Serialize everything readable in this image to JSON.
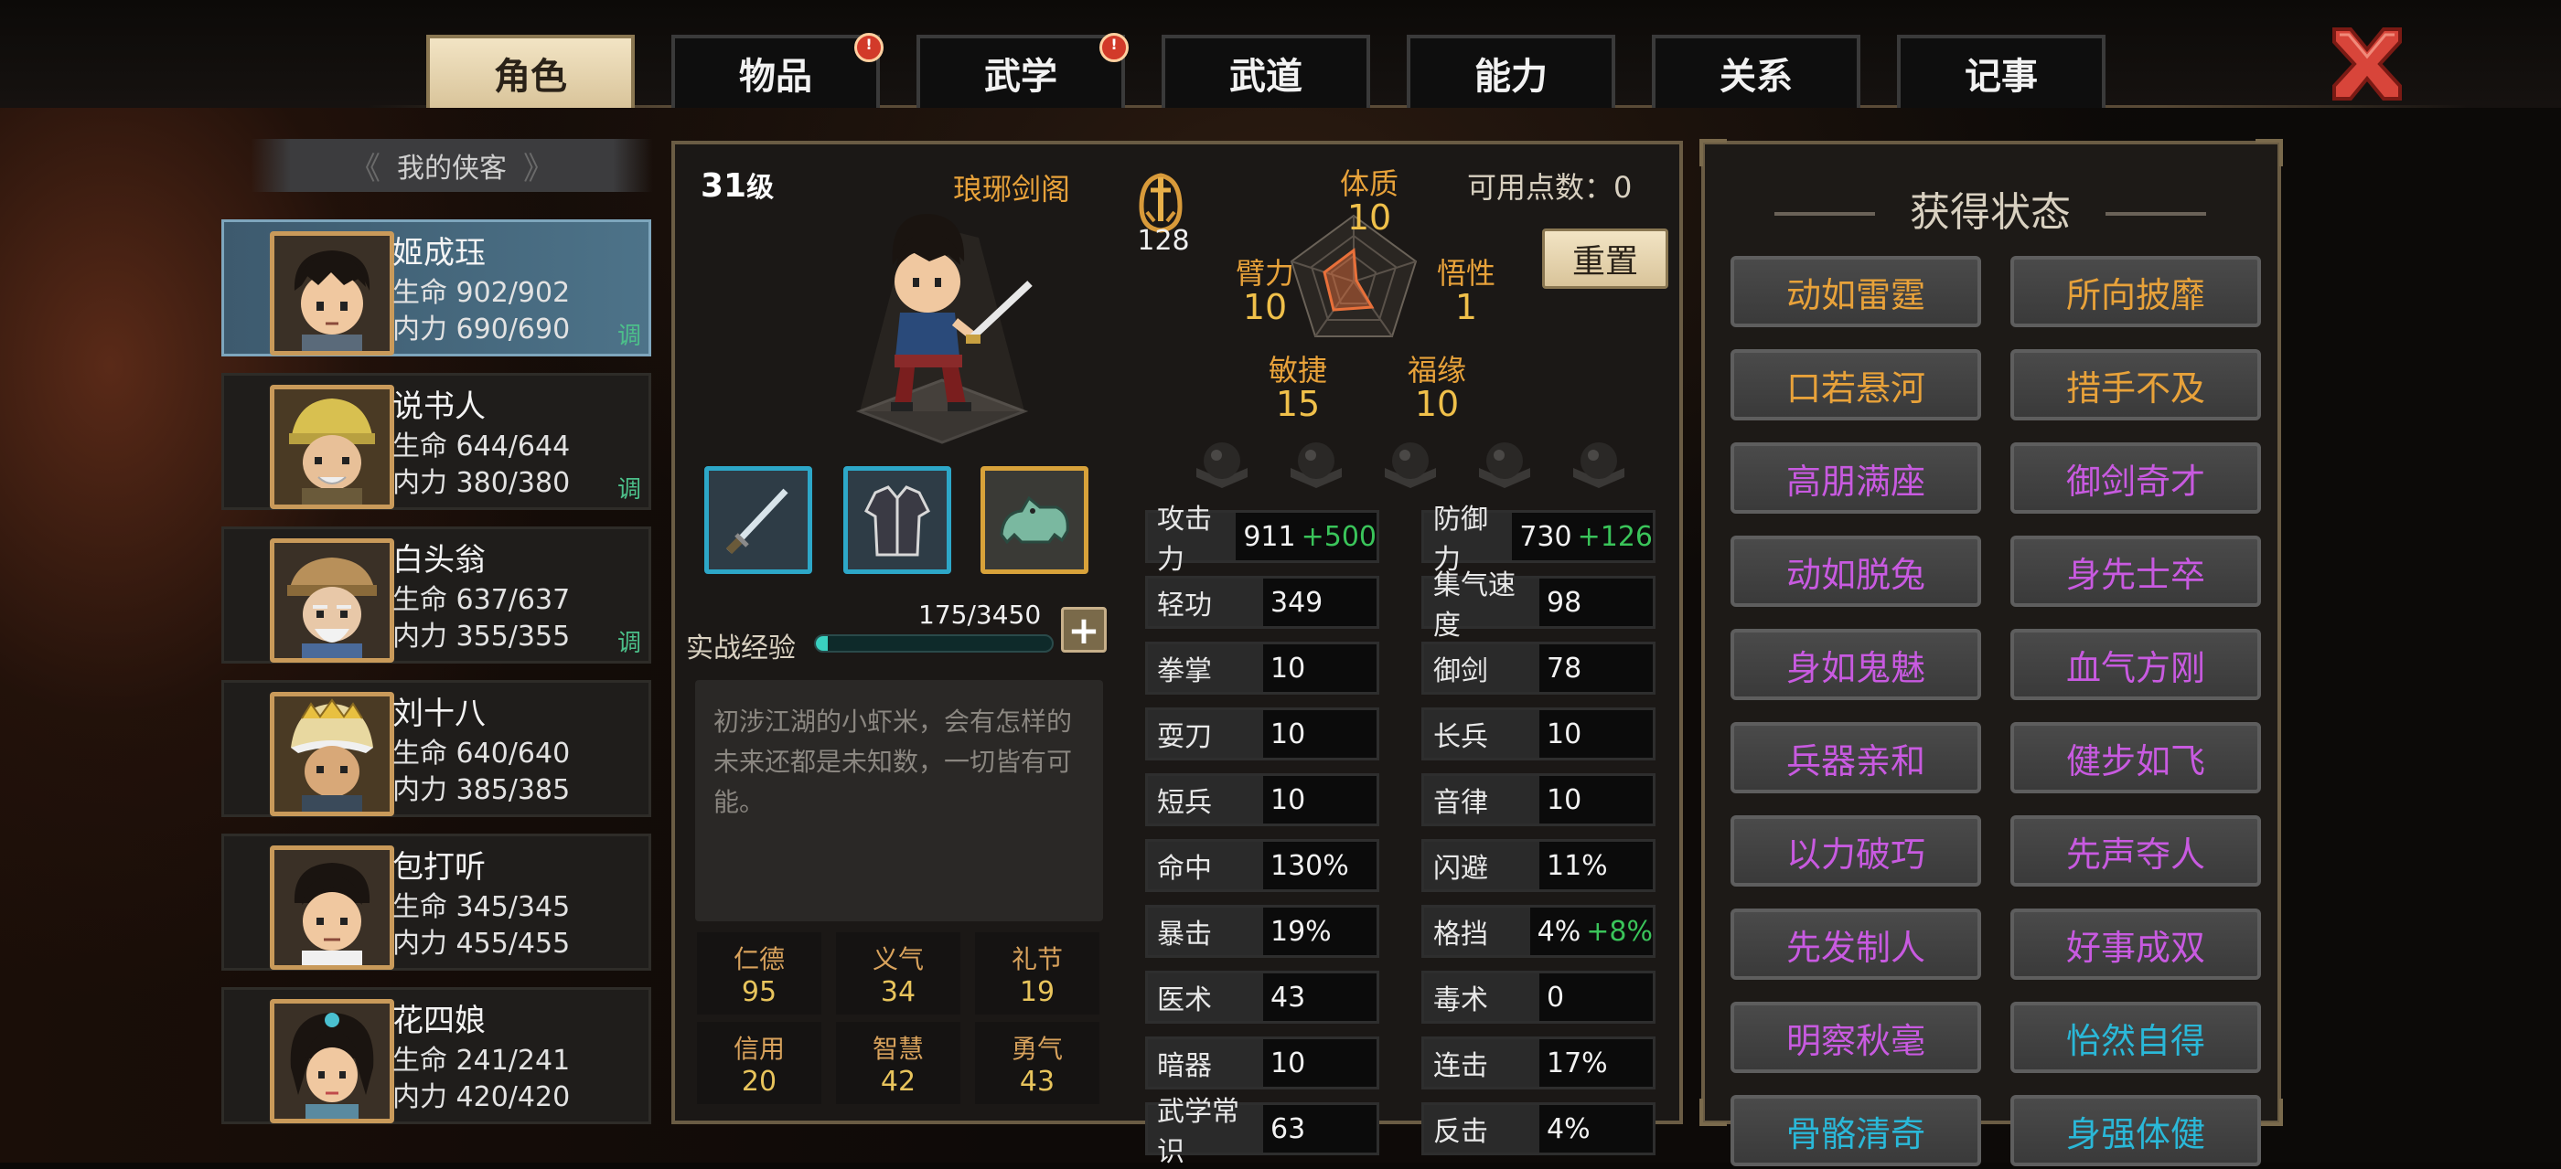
{
  "tabs": [
    {
      "label": "角色",
      "active": true,
      "badge": false
    },
    {
      "label": "物品",
      "active": false,
      "badge": true
    },
    {
      "label": "武学",
      "active": false,
      "badge": true
    },
    {
      "label": "武道",
      "active": false,
      "badge": false
    },
    {
      "label": "能力",
      "active": false,
      "badge": false
    },
    {
      "label": "关系",
      "active": false,
      "badge": false
    },
    {
      "label": "记事",
      "active": false,
      "badge": false
    }
  ],
  "badge_mark": "!",
  "section_title": "我的侠客",
  "heroes": [
    {
      "name": "姬成珏",
      "hp": "生命 902/902",
      "mp": "内力 690/690",
      "tag": "调"
    },
    {
      "name": "说书人",
      "hp": "生命 644/644",
      "mp": "内力 380/380",
      "tag": "调"
    },
    {
      "name": "白头翁",
      "hp": "生命 637/637",
      "mp": "内力 355/355",
      "tag": "调"
    },
    {
      "name": "刘十八",
      "hp": "生命 640/640",
      "mp": "内力 385/385",
      "tag": ""
    },
    {
      "name": "包打听",
      "hp": "生命 345/345",
      "mp": "内力 455/455",
      "tag": ""
    },
    {
      "name": "花四娘",
      "hp": "生命 241/241",
      "mp": "内力 420/420",
      "tag": ""
    }
  ],
  "character": {
    "level": "31",
    "level_unit": "级",
    "sect": "琅琊剑阁",
    "power": "128",
    "points_label": "可用点数：",
    "points": "0",
    "reset_label": "重置",
    "exp_label": "实战经验",
    "exp_text": "175/3450",
    "exp_progress": 0.051,
    "plus": "+",
    "description": "初涉江湖的小虾米，会有怎样的未来还都是未知数，一切皆有可能。"
  },
  "attributes": [
    {
      "name": "体质",
      "value": "10"
    },
    {
      "name": "悟性",
      "value": "1"
    },
    {
      "name": "福缘",
      "value": "10"
    },
    {
      "name": "敏捷",
      "value": "15"
    },
    {
      "name": "臂力",
      "value": "10"
    }
  ],
  "virtues": [
    {
      "name": "仁德",
      "value": "95"
    },
    {
      "name": "义气",
      "value": "34"
    },
    {
      "name": "礼节",
      "value": "19"
    },
    {
      "name": "信用",
      "value": "20"
    },
    {
      "name": "智慧",
      "value": "42"
    },
    {
      "name": "勇气",
      "value": "43"
    }
  ],
  "stats_left": [
    {
      "k": "攻击力",
      "v": "911",
      "b": "+500"
    },
    {
      "k": "轻功",
      "v": "349",
      "b": ""
    },
    {
      "k": "拳掌",
      "v": "10",
      "b": ""
    },
    {
      "k": "耍刀",
      "v": "10",
      "b": ""
    },
    {
      "k": "短兵",
      "v": "10",
      "b": ""
    },
    {
      "k": "命中",
      "v": "130%",
      "b": ""
    },
    {
      "k": "暴击",
      "v": "19%",
      "b": ""
    },
    {
      "k": "医术",
      "v": "43",
      "b": ""
    },
    {
      "k": "暗器",
      "v": "10",
      "b": ""
    },
    {
      "k": "武学常识",
      "v": "63",
      "b": ""
    }
  ],
  "stats_right": [
    {
      "k": "防御力",
      "v": "730",
      "b": "+126"
    },
    {
      "k": "集气速度",
      "v": "98",
      "b": ""
    },
    {
      "k": "御剑",
      "v": "78",
      "b": ""
    },
    {
      "k": "长兵",
      "v": "10",
      "b": ""
    },
    {
      "k": "音律",
      "v": "10",
      "b": ""
    },
    {
      "k": "闪避",
      "v": "11%",
      "b": ""
    },
    {
      "k": "格挡",
      "v": "4%",
      "b": "+8%"
    },
    {
      "k": "毒术",
      "v": "0",
      "b": ""
    },
    {
      "k": "连击",
      "v": "17%",
      "b": ""
    },
    {
      "k": "反击",
      "v": "4%",
      "b": ""
    }
  ],
  "status_title": "获得状态",
  "statuses": [
    {
      "label": "动如雷霆",
      "color": "#e8a23a"
    },
    {
      "label": "所向披靡",
      "color": "#e8a23a"
    },
    {
      "label": "口若悬河",
      "color": "#e8a23a"
    },
    {
      "label": "措手不及",
      "color": "#e8a23a"
    },
    {
      "label": "高朋满座",
      "color": "#c85ae0"
    },
    {
      "label": "御剑奇才",
      "color": "#c85ae0"
    },
    {
      "label": "动如脱兔",
      "color": "#c85ae0"
    },
    {
      "label": "身先士卒",
      "color": "#c85ae0"
    },
    {
      "label": "身如鬼魅",
      "color": "#c85ae0"
    },
    {
      "label": "血气方刚",
      "color": "#c85ae0"
    },
    {
      "label": "兵器亲和",
      "color": "#c85ae0"
    },
    {
      "label": "健步如飞",
      "color": "#c85ae0"
    },
    {
      "label": "以力破巧",
      "color": "#c85ae0"
    },
    {
      "label": "先声夺人",
      "color": "#c85ae0"
    },
    {
      "label": "先发制人",
      "color": "#c85ae0"
    },
    {
      "label": "好事成双",
      "color": "#c85ae0"
    },
    {
      "label": "明察秋毫",
      "color": "#c85ae0"
    },
    {
      "label": "怡然自得",
      "color": "#2ab8d8"
    },
    {
      "label": "骨骼清奇",
      "color": "#2ab8d8"
    },
    {
      "label": "身强体健",
      "color": "#2ab8d8"
    }
  ],
  "icons": {
    "close": "close-icon",
    "sword": "sword-icon",
    "robe": "robe-icon",
    "beast": "beast-icon",
    "power": "sword-emblem-icon"
  }
}
